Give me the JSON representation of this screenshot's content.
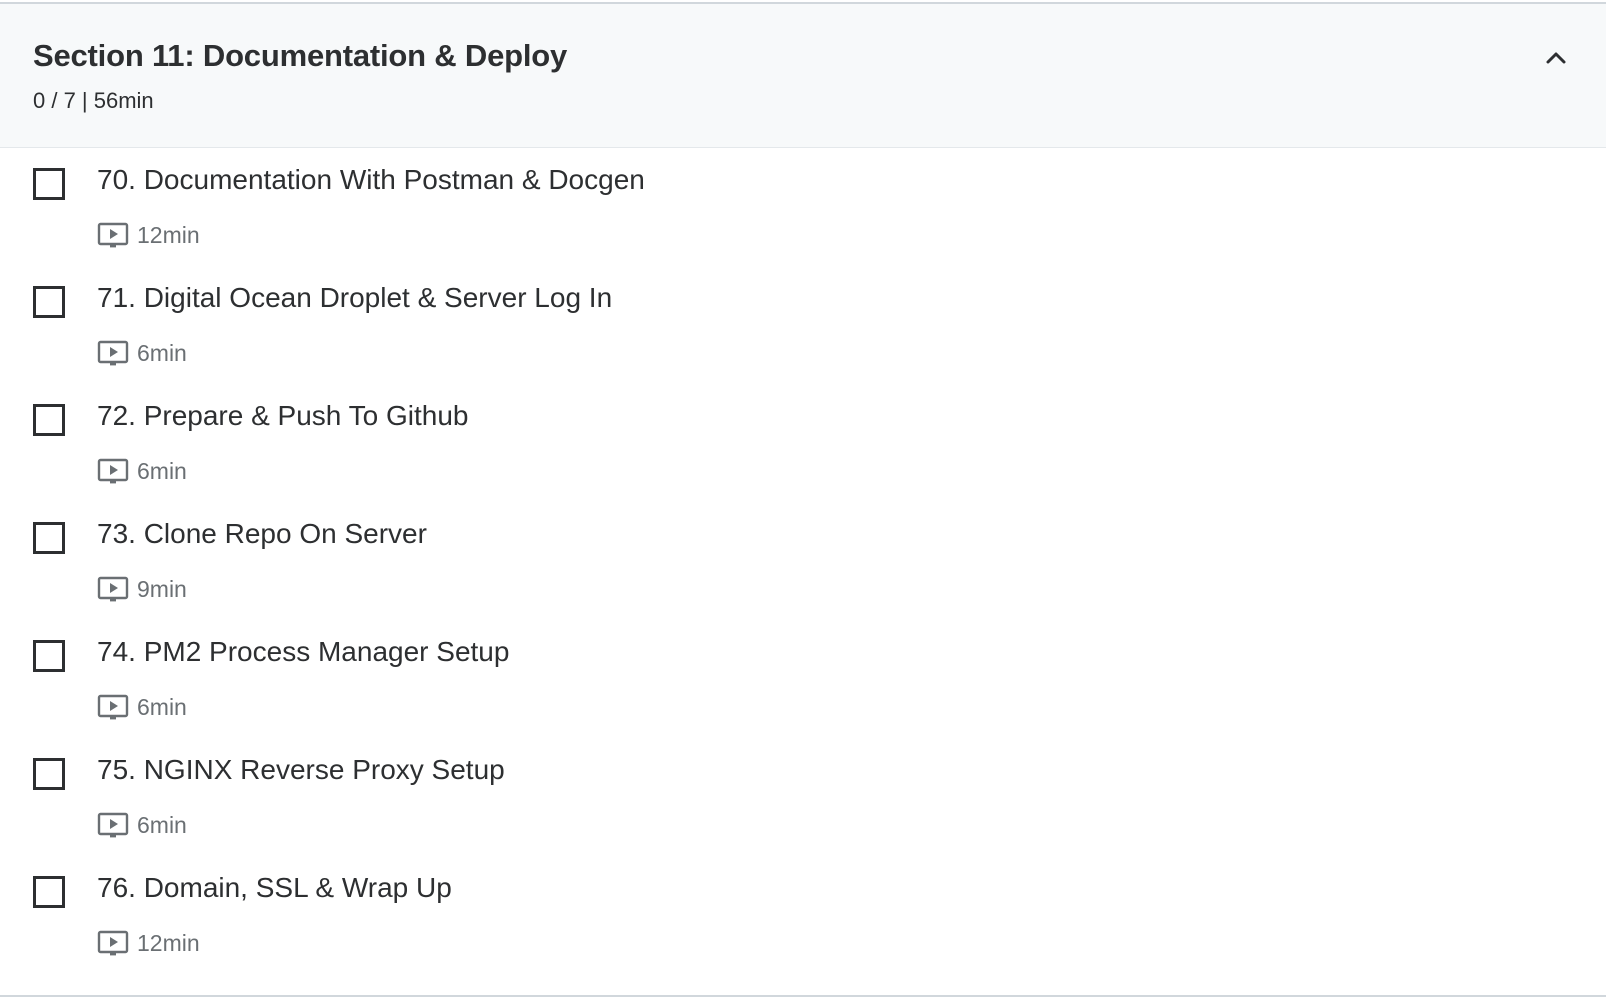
{
  "section": {
    "title": "Section 11: Documentation & Deploy",
    "meta": "0 / 7 | 56min",
    "collapse_icon": "chevron-up-icon"
  },
  "lectures": [
    {
      "title": "70. Documentation With Postman & Docgen",
      "duration": "12min",
      "completed": false,
      "icon": "video-icon"
    },
    {
      "title": "71. Digital Ocean Droplet & Server Log In",
      "duration": "6min",
      "completed": false,
      "icon": "video-icon"
    },
    {
      "title": "72. Prepare & Push To Github",
      "duration": "6min",
      "completed": false,
      "icon": "video-icon"
    },
    {
      "title": "73. Clone Repo On Server",
      "duration": "9min",
      "completed": false,
      "icon": "video-icon"
    },
    {
      "title": "74. PM2 Process Manager Setup",
      "duration": "6min",
      "completed": false,
      "icon": "video-icon"
    },
    {
      "title": "75. NGINX Reverse Proxy Setup",
      "duration": "6min",
      "completed": false,
      "icon": "video-icon"
    },
    {
      "title": "76. Domain, SSL & Wrap Up",
      "duration": "12min",
      "completed": false,
      "icon": "video-icon"
    }
  ],
  "colors": {
    "header_bg": "#f7f9fa",
    "text": "#2d2f31",
    "muted_text": "#6a6f73",
    "divider": "#d1d7dc"
  }
}
